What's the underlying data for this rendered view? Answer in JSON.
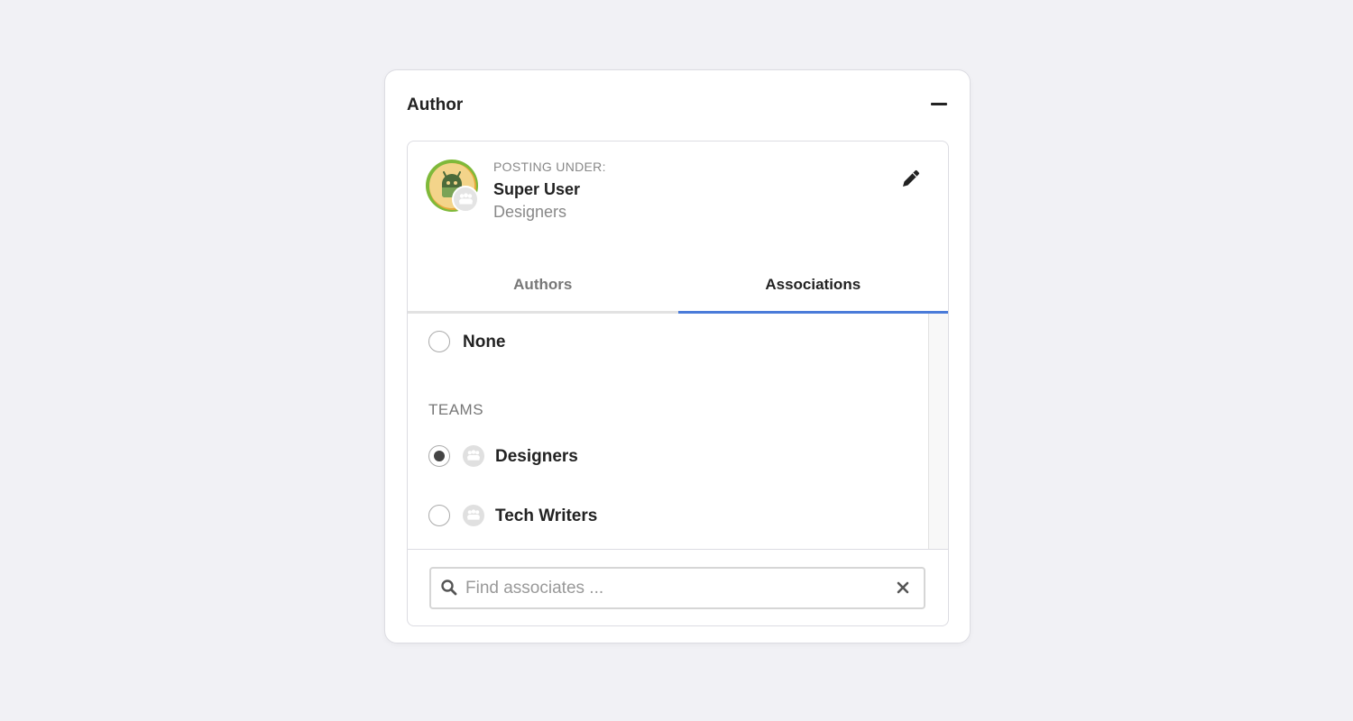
{
  "panel": {
    "title": "Author"
  },
  "posting": {
    "label": "POSTING UNDER:",
    "name": "Super User",
    "team": "Designers"
  },
  "tabs": [
    {
      "label": "Authors",
      "active": false
    },
    {
      "label": "Associations",
      "active": true
    }
  ],
  "list": {
    "none_label": "None",
    "section_label": "TEAMS",
    "teams": [
      {
        "label": "Designers",
        "selected": true
      },
      {
        "label": "Tech Writers",
        "selected": false
      }
    ]
  },
  "search": {
    "placeholder": "Find associates ...",
    "value": ""
  },
  "colors": {
    "background": "#f1f1f5",
    "accent": "#4a7bd9",
    "avatar_ring": "#7fb93a",
    "avatar_face": "#f3d48a",
    "avatar_robot": "#4c6b3a"
  },
  "icons": {
    "collapse": "minus-icon",
    "edit": "pencil-icon",
    "team": "team-icon",
    "search": "search-icon",
    "clear": "close-icon"
  }
}
